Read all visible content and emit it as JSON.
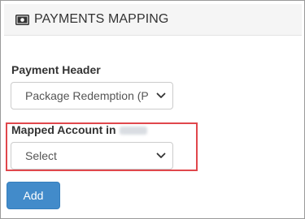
{
  "panel": {
    "title": "PAYMENTS MAPPING",
    "icon": "money-bill-icon"
  },
  "payment_header": {
    "label": "Payment Header",
    "selected": "Package Redemption (P"
  },
  "mapped_account": {
    "label": "Mapped Account in",
    "selected": "Select"
  },
  "actions": {
    "add_label": "Add"
  },
  "colors": {
    "header_bg": "#f5f5f5",
    "primary_button": "#428bca",
    "highlight": "#e0474c"
  }
}
